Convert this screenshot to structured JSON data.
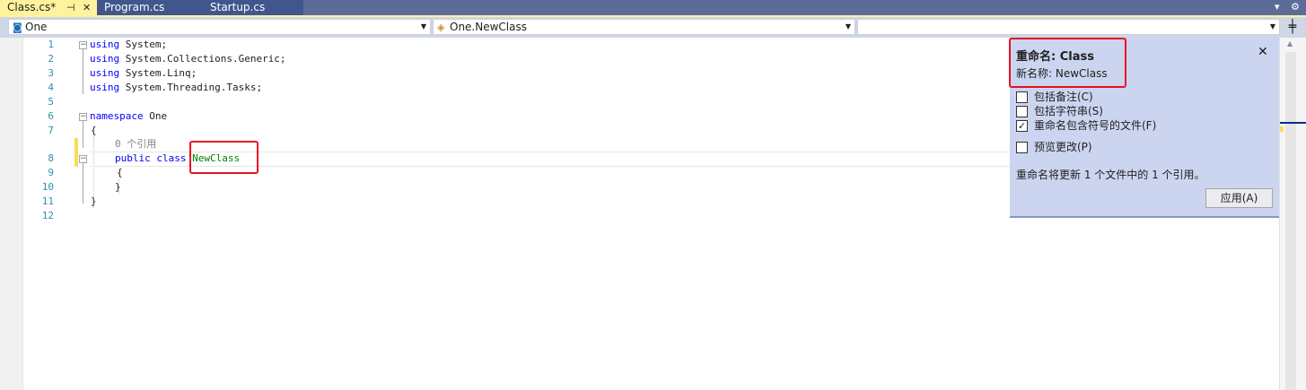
{
  "tabs": [
    {
      "label": "Class.cs*",
      "active": true
    },
    {
      "label": "Program.cs",
      "active": false
    },
    {
      "label": "Startup.cs",
      "active": false
    }
  ],
  "navbar": {
    "project": "One",
    "type": "One.NewClass",
    "member": ""
  },
  "code": {
    "line_numbers": [
      "1",
      "2",
      "3",
      "4",
      "5",
      "6",
      "7",
      "8",
      "9",
      "10",
      "11",
      "12"
    ],
    "line1": {
      "kw": "using",
      "rest": " System;"
    },
    "line2": {
      "kw": "using",
      "rest": " System.Collections.Generic;"
    },
    "line3": {
      "kw": "using",
      "rest": " System.Linq;"
    },
    "line4": {
      "kw": "using",
      "rest": " System.Threading.Tasks;"
    },
    "line6": {
      "kw": "namespace",
      "rest": " One"
    },
    "line7": "{",
    "codelens": "0 个引用",
    "line8": {
      "kw": "public class",
      "classname": "NewClass"
    },
    "line9": "{",
    "line10": "}",
    "line11": "}"
  },
  "rename_panel": {
    "title": "重命名: Class",
    "new_name": "新名称: NewClass",
    "options": [
      {
        "label": "包括备注(C)",
        "checked": false
      },
      {
        "label": "包括字符串(S)",
        "checked": false
      },
      {
        "label": "重命名包含符号的文件(F)",
        "checked": true
      },
      {
        "label": "预览更改(P)",
        "checked": false
      }
    ],
    "summary": "重命名将更新 1 个文件中的 1 个引用。",
    "apply_label": "应用(A)"
  },
  "colors": {
    "keyword": "#0000ff",
    "type_name": "#2b91af",
    "rename_bg": "#ccd5f0",
    "active_tab": "#fff29d",
    "highlight_box": "#e81123"
  }
}
